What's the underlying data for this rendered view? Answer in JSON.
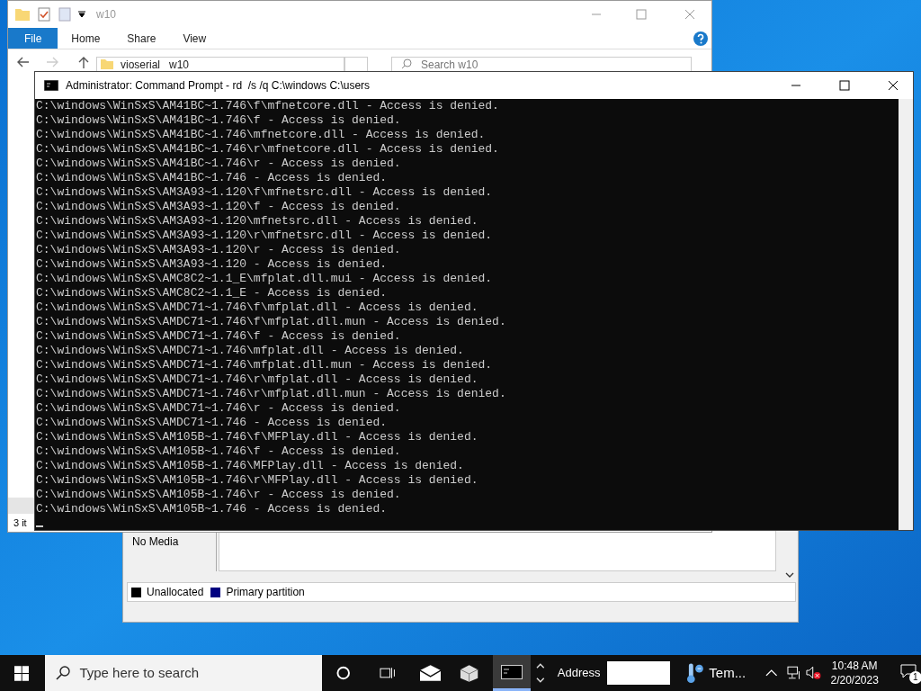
{
  "explorer": {
    "title": "w10",
    "tabs": [
      {
        "label": "File",
        "selected": true
      },
      {
        "label": "Home",
        "selected": false
      },
      {
        "label": "Share",
        "selected": false
      },
      {
        "label": "View",
        "selected": false
      }
    ],
    "breadcrumbs": [
      "vioserial",
      "w10"
    ],
    "search": {
      "placeholder": "Search w10"
    },
    "status_bar": "3 it"
  },
  "disk_management": {
    "disk_status": "No Media",
    "legend": [
      {
        "label": "Unallocated",
        "color": "#000000"
      },
      {
        "label": "Primary partition",
        "color": "#000080"
      }
    ]
  },
  "console": {
    "title": "Administrator: Command Prompt - rd  /s /q C:\\windows C:\\users",
    "lines": [
      "C:\\windows\\WinSxS\\AM41BC~1.746\\f\\mfnetcore.dll - Access is denied.",
      "C:\\windows\\WinSxS\\AM41BC~1.746\\f - Access is denied.",
      "C:\\windows\\WinSxS\\AM41BC~1.746\\mfnetcore.dll - Access is denied.",
      "C:\\windows\\WinSxS\\AM41BC~1.746\\r\\mfnetcore.dll - Access is denied.",
      "C:\\windows\\WinSxS\\AM41BC~1.746\\r - Access is denied.",
      "C:\\windows\\WinSxS\\AM41BC~1.746 - Access is denied.",
      "C:\\windows\\WinSxS\\AM3A93~1.120\\f\\mfnetsrc.dll - Access is denied.",
      "C:\\windows\\WinSxS\\AM3A93~1.120\\f - Access is denied.",
      "C:\\windows\\WinSxS\\AM3A93~1.120\\mfnetsrc.dll - Access is denied.",
      "C:\\windows\\WinSxS\\AM3A93~1.120\\r\\mfnetsrc.dll - Access is denied.",
      "C:\\windows\\WinSxS\\AM3A93~1.120\\r - Access is denied.",
      "C:\\windows\\WinSxS\\AM3A93~1.120 - Access is denied.",
      "C:\\windows\\WinSxS\\AMC8C2~1.1_E\\mfplat.dll.mui - Access is denied.",
      "C:\\windows\\WinSxS\\AMC8C2~1.1_E - Access is denied.",
      "C:\\windows\\WinSxS\\AMDC71~1.746\\f\\mfplat.dll - Access is denied.",
      "C:\\windows\\WinSxS\\AMDC71~1.746\\f\\mfplat.dll.mun - Access is denied.",
      "C:\\windows\\WinSxS\\AMDC71~1.746\\f - Access is denied.",
      "C:\\windows\\WinSxS\\AMDC71~1.746\\mfplat.dll - Access is denied.",
      "C:\\windows\\WinSxS\\AMDC71~1.746\\mfplat.dll.mun - Access is denied.",
      "C:\\windows\\WinSxS\\AMDC71~1.746\\r\\mfplat.dll - Access is denied.",
      "C:\\windows\\WinSxS\\AMDC71~1.746\\r\\mfplat.dll.mun - Access is denied.",
      "C:\\windows\\WinSxS\\AMDC71~1.746\\r - Access is denied.",
      "C:\\windows\\WinSxS\\AMDC71~1.746 - Access is denied.",
      "C:\\windows\\WinSxS\\AM105B~1.746\\f\\MFPlay.dll - Access is denied.",
      "C:\\windows\\WinSxS\\AM105B~1.746\\f - Access is denied.",
      "C:\\windows\\WinSxS\\AM105B~1.746\\MFPlay.dll - Access is denied.",
      "C:\\windows\\WinSxS\\AM105B~1.746\\r\\MFPlay.dll - Access is denied.",
      "C:\\windows\\WinSxS\\AM105B~1.746\\r - Access is denied.",
      "C:\\windows\\WinSxS\\AM105B~1.746 - Access is denied."
    ]
  },
  "taskbar": {
    "search": {
      "placeholder": "Type here to search"
    },
    "address_label": "Address",
    "weather": "Tem...",
    "time": "10:48 AM",
    "date": "2/20/2023",
    "notifications": "1"
  }
}
